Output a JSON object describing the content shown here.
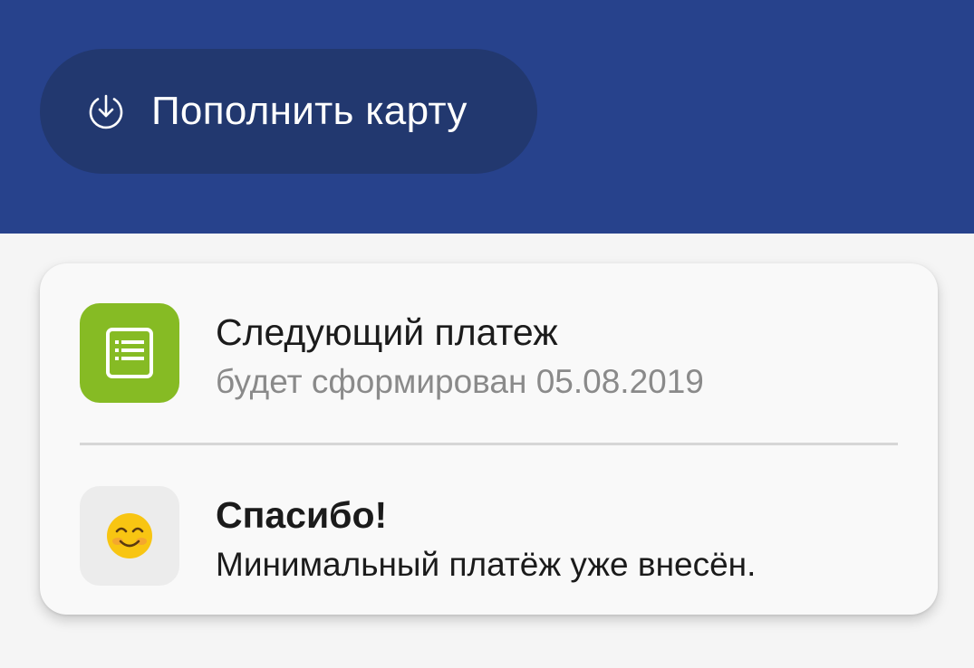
{
  "header": {
    "topup_button": {
      "label": "Пополнить карту",
      "icon": "download-circle-icon"
    },
    "colors": {
      "background": "#27428c",
      "button": "#22386f"
    }
  },
  "card": {
    "next_payment": {
      "icon": "statement-list-icon",
      "icon_color": "#86bb24",
      "title": "Следующий платеж",
      "subtitle": "будет сформирован 05.08.2019"
    },
    "thanks": {
      "icon": "smiling-face-emoji",
      "emoji": "😊",
      "title": "Спасибо!",
      "subtitle": "Минимальный платёж уже внесён."
    }
  }
}
